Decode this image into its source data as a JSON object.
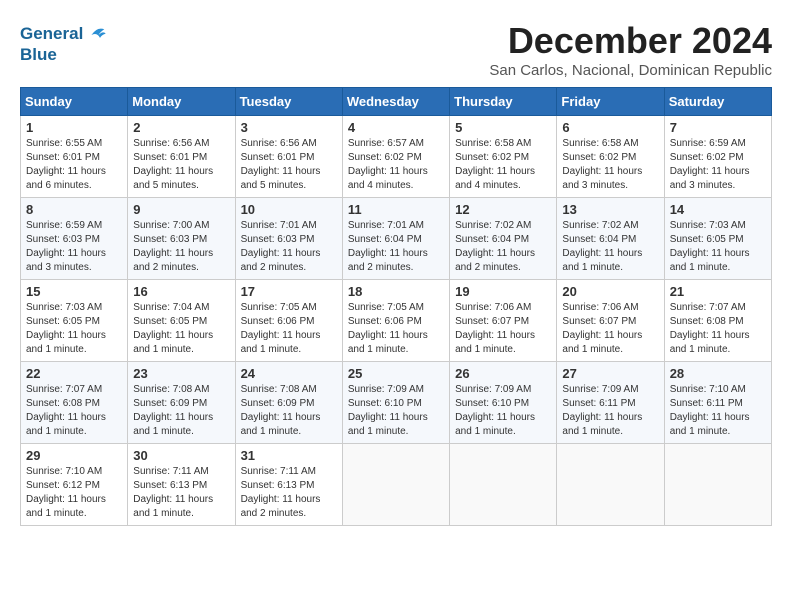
{
  "logo": {
    "line1": "General",
    "line2": "Blue"
  },
  "title": "December 2024",
  "location": "San Carlos, Nacional, Dominican Republic",
  "days_of_week": [
    "Sunday",
    "Monday",
    "Tuesday",
    "Wednesday",
    "Thursday",
    "Friday",
    "Saturday"
  ],
  "weeks": [
    [
      {
        "day": "1",
        "sunrise": "6:55 AM",
        "sunset": "6:01 PM",
        "daylight": "11 hours and 6 minutes."
      },
      {
        "day": "2",
        "sunrise": "6:56 AM",
        "sunset": "6:01 PM",
        "daylight": "11 hours and 5 minutes."
      },
      {
        "day": "3",
        "sunrise": "6:56 AM",
        "sunset": "6:01 PM",
        "daylight": "11 hours and 5 minutes."
      },
      {
        "day": "4",
        "sunrise": "6:57 AM",
        "sunset": "6:02 PM",
        "daylight": "11 hours and 4 minutes."
      },
      {
        "day": "5",
        "sunrise": "6:58 AM",
        "sunset": "6:02 PM",
        "daylight": "11 hours and 4 minutes."
      },
      {
        "day": "6",
        "sunrise": "6:58 AM",
        "sunset": "6:02 PM",
        "daylight": "11 hours and 3 minutes."
      },
      {
        "day": "7",
        "sunrise": "6:59 AM",
        "sunset": "6:02 PM",
        "daylight": "11 hours and 3 minutes."
      }
    ],
    [
      {
        "day": "8",
        "sunrise": "6:59 AM",
        "sunset": "6:03 PM",
        "daylight": "11 hours and 3 minutes."
      },
      {
        "day": "9",
        "sunrise": "7:00 AM",
        "sunset": "6:03 PM",
        "daylight": "11 hours and 2 minutes."
      },
      {
        "day": "10",
        "sunrise": "7:01 AM",
        "sunset": "6:03 PM",
        "daylight": "11 hours and 2 minutes."
      },
      {
        "day": "11",
        "sunrise": "7:01 AM",
        "sunset": "6:04 PM",
        "daylight": "11 hours and 2 minutes."
      },
      {
        "day": "12",
        "sunrise": "7:02 AM",
        "sunset": "6:04 PM",
        "daylight": "11 hours and 2 minutes."
      },
      {
        "day": "13",
        "sunrise": "7:02 AM",
        "sunset": "6:04 PM",
        "daylight": "11 hours and 1 minute."
      },
      {
        "day": "14",
        "sunrise": "7:03 AM",
        "sunset": "6:05 PM",
        "daylight": "11 hours and 1 minute."
      }
    ],
    [
      {
        "day": "15",
        "sunrise": "7:03 AM",
        "sunset": "6:05 PM",
        "daylight": "11 hours and 1 minute."
      },
      {
        "day": "16",
        "sunrise": "7:04 AM",
        "sunset": "6:05 PM",
        "daylight": "11 hours and 1 minute."
      },
      {
        "day": "17",
        "sunrise": "7:05 AM",
        "sunset": "6:06 PM",
        "daylight": "11 hours and 1 minute."
      },
      {
        "day": "18",
        "sunrise": "7:05 AM",
        "sunset": "6:06 PM",
        "daylight": "11 hours and 1 minute."
      },
      {
        "day": "19",
        "sunrise": "7:06 AM",
        "sunset": "6:07 PM",
        "daylight": "11 hours and 1 minute."
      },
      {
        "day": "20",
        "sunrise": "7:06 AM",
        "sunset": "6:07 PM",
        "daylight": "11 hours and 1 minute."
      },
      {
        "day": "21",
        "sunrise": "7:07 AM",
        "sunset": "6:08 PM",
        "daylight": "11 hours and 1 minute."
      }
    ],
    [
      {
        "day": "22",
        "sunrise": "7:07 AM",
        "sunset": "6:08 PM",
        "daylight": "11 hours and 1 minute."
      },
      {
        "day": "23",
        "sunrise": "7:08 AM",
        "sunset": "6:09 PM",
        "daylight": "11 hours and 1 minute."
      },
      {
        "day": "24",
        "sunrise": "7:08 AM",
        "sunset": "6:09 PM",
        "daylight": "11 hours and 1 minute."
      },
      {
        "day": "25",
        "sunrise": "7:09 AM",
        "sunset": "6:10 PM",
        "daylight": "11 hours and 1 minute."
      },
      {
        "day": "26",
        "sunrise": "7:09 AM",
        "sunset": "6:10 PM",
        "daylight": "11 hours and 1 minute."
      },
      {
        "day": "27",
        "sunrise": "7:09 AM",
        "sunset": "6:11 PM",
        "daylight": "11 hours and 1 minute."
      },
      {
        "day": "28",
        "sunrise": "7:10 AM",
        "sunset": "6:11 PM",
        "daylight": "11 hours and 1 minute."
      }
    ],
    [
      {
        "day": "29",
        "sunrise": "7:10 AM",
        "sunset": "6:12 PM",
        "daylight": "11 hours and 1 minute."
      },
      {
        "day": "30",
        "sunrise": "7:11 AM",
        "sunset": "6:13 PM",
        "daylight": "11 hours and 1 minute."
      },
      {
        "day": "31",
        "sunrise": "7:11 AM",
        "sunset": "6:13 PM",
        "daylight": "11 hours and 2 minutes."
      },
      null,
      null,
      null,
      null
    ]
  ]
}
